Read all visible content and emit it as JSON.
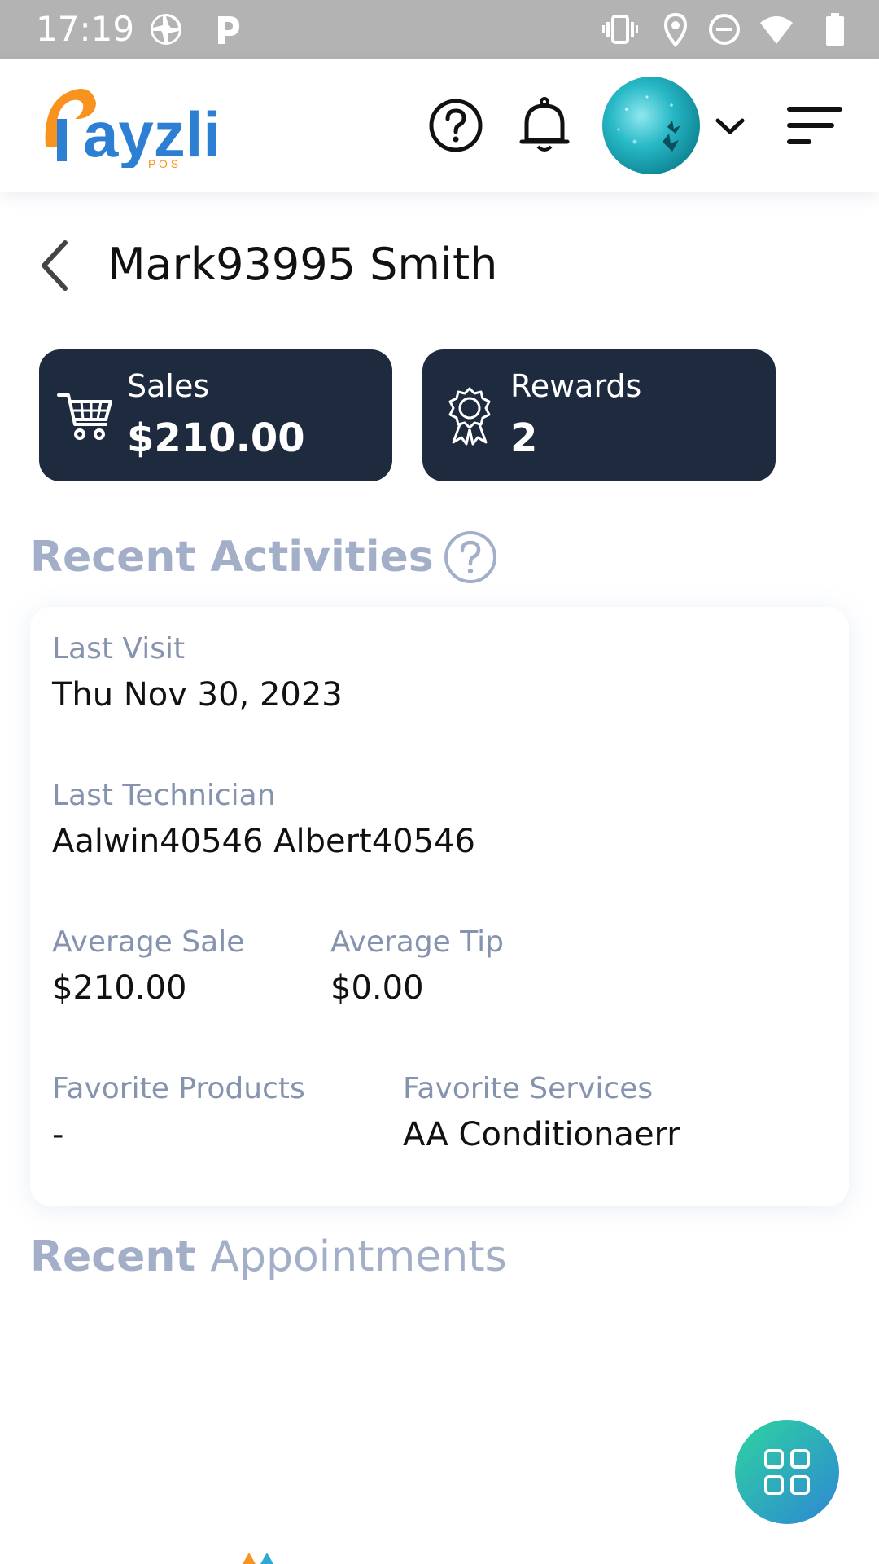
{
  "status_bar": {
    "time": "17:19"
  },
  "header": {
    "logo_text": "ayzli",
    "logo_sub": "P O S",
    "icons": [
      "help-icon",
      "notification-bell-icon",
      "avatar",
      "chevron-down-icon",
      "menu-icon"
    ]
  },
  "customer": {
    "name": "Mark93995 Smith"
  },
  "stats": {
    "sales": {
      "label": "Sales",
      "value": "$210.00"
    },
    "rewards": {
      "label": "Rewards",
      "value": "2"
    }
  },
  "recent_activities": {
    "heading": "Recent Activities",
    "last_visit": {
      "label": "Last Visit",
      "value": "Thu Nov 30, 2023"
    },
    "last_technician": {
      "label": "Last Technician",
      "value": "Aalwin40546 Albert40546"
    },
    "average_sale": {
      "label": "Average Sale",
      "value": "$210.00"
    },
    "average_tip": {
      "label": "Average Tip",
      "value": "$0.00"
    },
    "favorite_products": {
      "label": "Favorite Products",
      "value": "-"
    },
    "favorite_services": {
      "label": "Favorite Services",
      "value": "AA Conditionaerr"
    }
  },
  "recent_appointments": {
    "heading_bold": "Recent",
    "heading_light": "Appointments"
  },
  "colors": {
    "status_bar": "#b3b3b3",
    "card_dark": "#1e2a3e",
    "heading_muted": "#a3afc8",
    "label_muted": "#8593af",
    "logo_orange": "#f7931e",
    "logo_blue": "#2d7fd3",
    "fab_start": "#2dd4a0",
    "fab_end": "#2f86d4"
  }
}
